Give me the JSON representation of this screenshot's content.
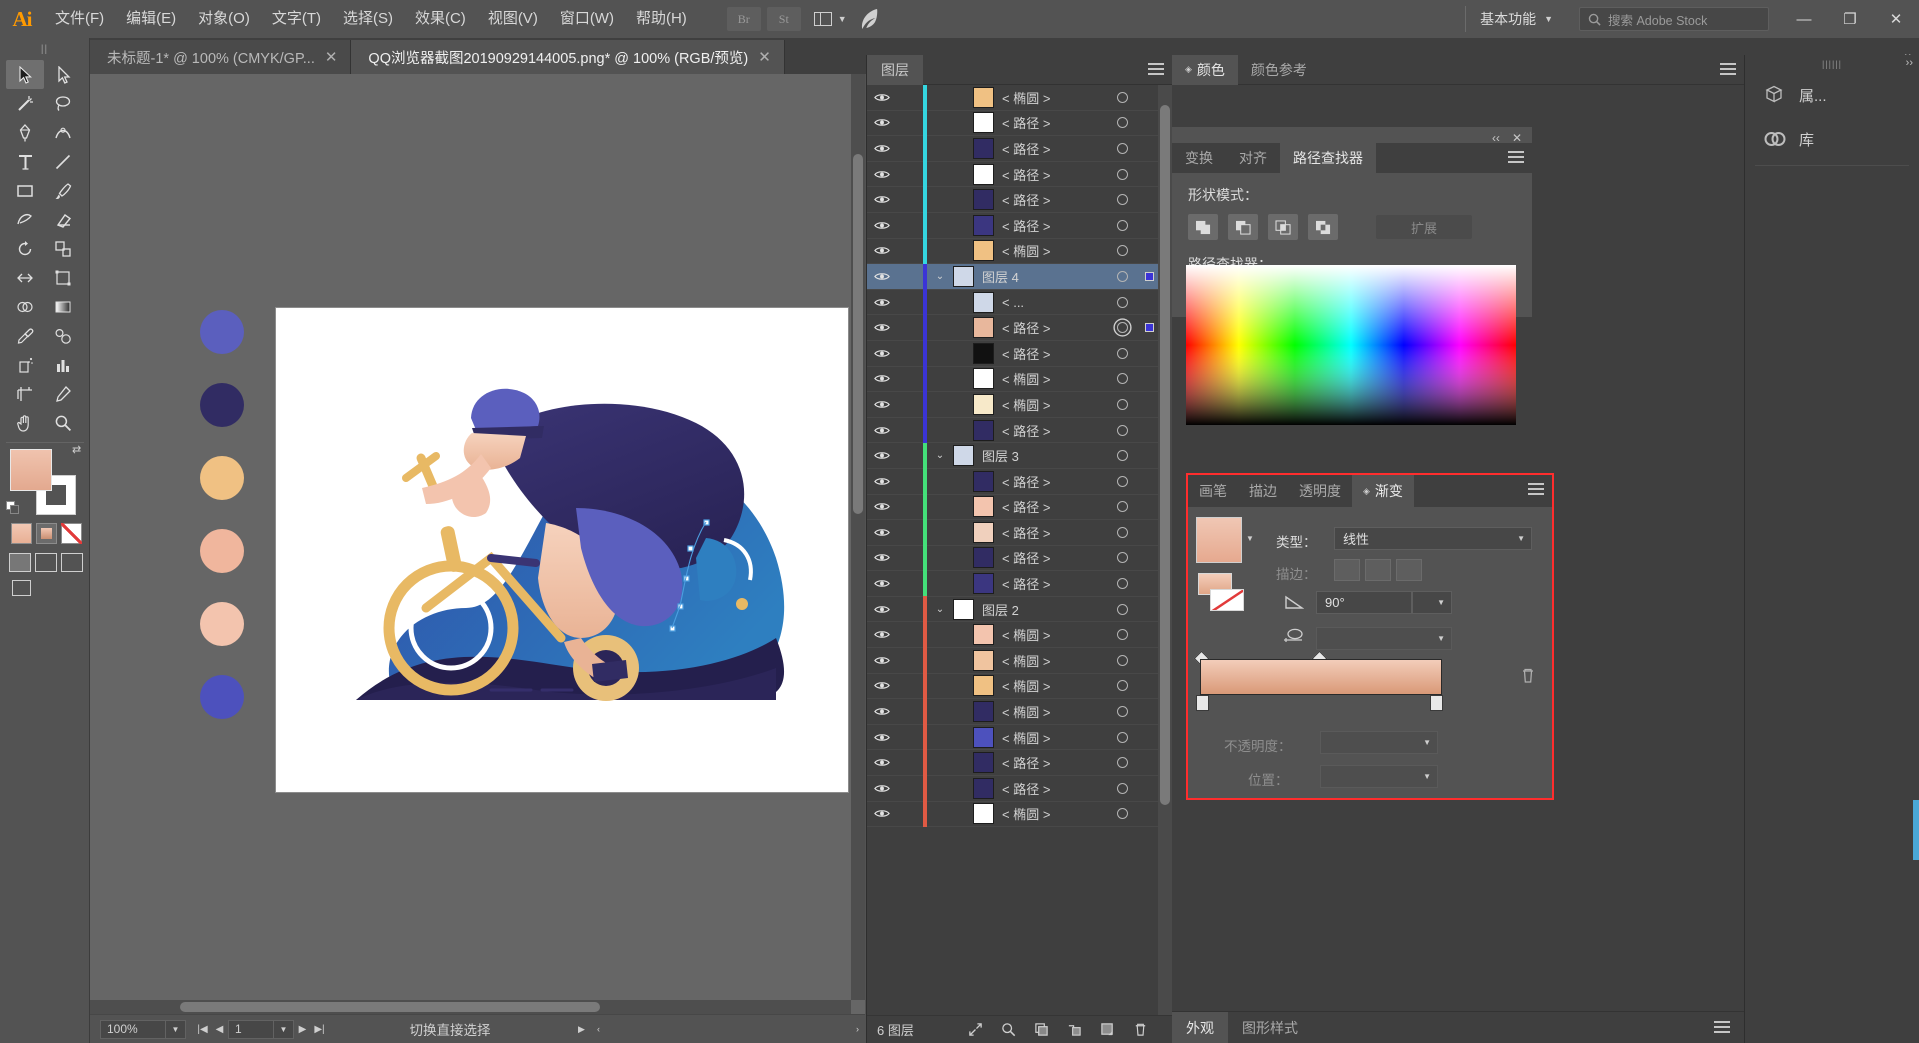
{
  "app": {
    "name": "Adobe Illustrator",
    "logo": "Ai",
    "bg_color": "#535353",
    "accent_color": "#ff9a00"
  },
  "menubar": {
    "items": [
      {
        "label": "文件(F)",
        "name": "menu-file"
      },
      {
        "label": "编辑(E)",
        "name": "menu-edit"
      },
      {
        "label": "对象(O)",
        "name": "menu-object"
      },
      {
        "label": "文字(T)",
        "name": "menu-type"
      },
      {
        "label": "选择(S)",
        "name": "menu-select"
      },
      {
        "label": "效果(C)",
        "name": "menu-effect"
      },
      {
        "label": "视图(V)",
        "name": "menu-view"
      },
      {
        "label": "窗口(W)",
        "name": "menu-window"
      },
      {
        "label": "帮助(H)",
        "name": "menu-help"
      }
    ],
    "bridge_label": "Br",
    "stock_label": "St",
    "workspace": "基本功能",
    "search_placeholder": "搜索 Adobe Stock",
    "win_minimize": "—",
    "win_restore": "❐",
    "win_close": "✕"
  },
  "tabs": [
    {
      "label": "未标题-1* @ 100% (CMYK/GP...",
      "active": false,
      "close": "✕"
    },
    {
      "label": "QQ浏览器截图20190929144005.png* @ 100% (RGB/预览)",
      "active": true,
      "close": "✕"
    }
  ],
  "toolbar": {
    "grip": "||",
    "tools": [
      {
        "name": "selection-tool",
        "selected": true
      },
      {
        "name": "direct-selection-tool",
        "selected": false
      },
      {
        "name": "magic-wand-tool",
        "selected": false
      },
      {
        "name": "lasso-tool",
        "selected": false
      },
      {
        "name": "pen-tool",
        "selected": false
      },
      {
        "name": "curvature-tool",
        "selected": false
      },
      {
        "name": "type-tool",
        "selected": false
      },
      {
        "name": "line-segment-tool",
        "selected": false
      },
      {
        "name": "rectangle-tool",
        "selected": false
      },
      {
        "name": "paintbrush-tool",
        "selected": false
      },
      {
        "name": "shaper-tool",
        "selected": false
      },
      {
        "name": "eraser-tool",
        "selected": false
      },
      {
        "name": "rotate-tool",
        "selected": false
      },
      {
        "name": "scale-tool",
        "selected": false
      },
      {
        "name": "width-tool",
        "selected": false
      },
      {
        "name": "free-transform-tool",
        "selected": false
      },
      {
        "name": "shape-builder-tool",
        "selected": false
      },
      {
        "name": "gradient-tool",
        "selected": false
      },
      {
        "name": "eyedropper-tool",
        "selected": false
      },
      {
        "name": "blend-tool",
        "selected": false
      },
      {
        "name": "symbol-sprayer-tool",
        "selected": false
      },
      {
        "name": "column-graph-tool",
        "selected": false
      },
      {
        "name": "artboard-tool",
        "selected": false
      },
      {
        "name": "slice-tool",
        "selected": false
      },
      {
        "name": "hand-tool",
        "selected": false
      },
      {
        "name": "zoom-tool",
        "selected": false
      }
    ]
  },
  "canvas": {
    "artboard_bg": "#ffffff",
    "swatches": [
      {
        "color": "#5b5fbe",
        "name": "swatch-indigo"
      },
      {
        "color": "#312c63",
        "name": "swatch-dark-navy"
      },
      {
        "color": "#f0c183",
        "name": "swatch-gold"
      },
      {
        "color": "#f0b69d",
        "name": "swatch-salmon"
      },
      {
        "color": "#f3c4ae",
        "name": "swatch-peach"
      },
      {
        "color": "#4d51bd",
        "name": "swatch-blue"
      }
    ],
    "illustration_alt": "Flat illustration of a cyclist riding a bicycle"
  },
  "statusbar": {
    "zoom": "100%",
    "page": "1",
    "status_text": "切换直接选择"
  },
  "layers_panel": {
    "tab_label": "图层",
    "footer_count": "6 图层",
    "footer_icons": [
      {
        "name": "locate-object-icon"
      },
      {
        "name": "make-clipping-mask-icon"
      },
      {
        "name": "create-new-sublayer-icon"
      },
      {
        "name": "create-new-layer-icon"
      },
      {
        "name": "delete-selection-icon"
      }
    ],
    "rows": [
      {
        "label": "< 椭圆 >",
        "type": "object",
        "indent": 2,
        "color": "#35d6e0",
        "thumb": "#f0c183",
        "selected": false,
        "target": "single",
        "has_sel_square": false,
        "expandable": false
      },
      {
        "label": "< 路径 >",
        "type": "object",
        "indent": 2,
        "color": "#35d6e0",
        "thumb": "#ffffff",
        "selected": false,
        "target": "single",
        "has_sel_square": false,
        "expandable": false
      },
      {
        "label": "< 路径 >",
        "type": "object",
        "indent": 2,
        "color": "#35d6e0",
        "thumb": "#312c63",
        "selected": false,
        "target": "single",
        "has_sel_square": false,
        "expandable": false
      },
      {
        "label": "< 路径 >",
        "type": "object",
        "indent": 2,
        "color": "#35d6e0",
        "thumb": "#ffffff",
        "selected": false,
        "target": "single",
        "has_sel_square": false,
        "expandable": false
      },
      {
        "label": "< 路径 >",
        "type": "object",
        "indent": 2,
        "color": "#35d6e0",
        "thumb": "#312c63",
        "selected": false,
        "target": "single",
        "has_sel_square": false,
        "expandable": false
      },
      {
        "label": "< 路径 >",
        "type": "object",
        "indent": 2,
        "color": "#35d6e0",
        "thumb": "#3b3680",
        "selected": false,
        "target": "single",
        "has_sel_square": false,
        "expandable": false
      },
      {
        "label": "< 椭圆 >",
        "type": "object",
        "indent": 2,
        "color": "#35d6e0",
        "thumb": "#f0c183",
        "selected": false,
        "target": "single",
        "has_sel_square": false,
        "expandable": false
      },
      {
        "label": "图层 4",
        "type": "layer",
        "indent": 0,
        "color": "#3b34d6",
        "thumb": "#cfd8e8",
        "selected": true,
        "target": "single",
        "has_sel_square": true,
        "expandable": true
      },
      {
        "label": "< ...",
        "type": "object",
        "indent": 2,
        "color": "#3b34d6",
        "thumb": "#cfd8e8",
        "selected": false,
        "target": "single",
        "has_sel_square": false,
        "expandable": false
      },
      {
        "label": "< 路径 >",
        "type": "object",
        "indent": 2,
        "color": "#3b34d6",
        "thumb": "#e8b79c",
        "selected": false,
        "target": "double",
        "has_sel_square": true,
        "expandable": false
      },
      {
        "label": "< 路径 >",
        "type": "object",
        "indent": 2,
        "color": "#3b34d6",
        "thumb": "#111111",
        "selected": false,
        "target": "single",
        "has_sel_square": false,
        "expandable": false
      },
      {
        "label": "< 椭圆 >",
        "type": "object",
        "indent": 2,
        "color": "#3b34d6",
        "thumb": "#ffffff",
        "selected": false,
        "target": "single",
        "has_sel_square": false,
        "expandable": false
      },
      {
        "label": "< 椭圆 >",
        "type": "object",
        "indent": 2,
        "color": "#3b34d6",
        "thumb": "#f7e9c9",
        "selected": false,
        "target": "single",
        "has_sel_square": false,
        "expandable": false
      },
      {
        "label": "< 路径 >",
        "type": "object",
        "indent": 2,
        "color": "#3b34d6",
        "thumb": "#312c63",
        "selected": false,
        "target": "single",
        "has_sel_square": false,
        "expandable": false
      },
      {
        "label": "图层 3",
        "type": "layer",
        "indent": 0,
        "color": "#44e07a",
        "thumb": "#cfd8e8",
        "selected": false,
        "target": "single",
        "has_sel_square": false,
        "expandable": true
      },
      {
        "label": "< 路径 >",
        "type": "object",
        "indent": 2,
        "color": "#44e07a",
        "thumb": "#312c63",
        "selected": false,
        "target": "single",
        "has_sel_square": false,
        "expandable": false
      },
      {
        "label": "< 路径 >",
        "type": "object",
        "indent": 2,
        "color": "#44e07a",
        "thumb": "#f3c4ae",
        "selected": false,
        "target": "single",
        "has_sel_square": false,
        "expandable": false
      },
      {
        "label": "< 路径 >",
        "type": "object",
        "indent": 2,
        "color": "#44e07a",
        "thumb": "#f0d0bd",
        "selected": false,
        "target": "single",
        "has_sel_square": false,
        "expandable": false
      },
      {
        "label": "< 路径 >",
        "type": "object",
        "indent": 2,
        "color": "#44e07a",
        "thumb": "#312c63",
        "selected": false,
        "target": "single",
        "has_sel_square": false,
        "expandable": false
      },
      {
        "label": "< 路径 >",
        "type": "object",
        "indent": 2,
        "color": "#44e07a",
        "thumb": "#3b3680",
        "selected": false,
        "target": "single",
        "has_sel_square": false,
        "expandable": false
      },
      {
        "label": "图层 2",
        "type": "layer",
        "indent": 0,
        "color": "#e05a44",
        "thumb": "#ffffff",
        "selected": false,
        "target": "single",
        "has_sel_square": false,
        "expandable": true
      },
      {
        "label": "< 椭圆 >",
        "type": "object",
        "indent": 2,
        "color": "#e05a44",
        "thumb": "#f3c4ae",
        "selected": false,
        "target": "single",
        "has_sel_square": false,
        "expandable": false
      },
      {
        "label": "< 椭圆 >",
        "type": "object",
        "indent": 2,
        "color": "#e05a44",
        "thumb": "#f0c49f",
        "selected": false,
        "target": "single",
        "has_sel_square": false,
        "expandable": false
      },
      {
        "label": "< 椭圆 >",
        "type": "object",
        "indent": 2,
        "color": "#e05a44",
        "thumb": "#f0c183",
        "selected": false,
        "target": "single",
        "has_sel_square": false,
        "expandable": false
      },
      {
        "label": "< 椭圆 >",
        "type": "object",
        "indent": 2,
        "color": "#e05a44",
        "thumb": "#312c63",
        "selected": false,
        "target": "single",
        "has_sel_square": false,
        "expandable": false
      },
      {
        "label": "< 椭圆 >",
        "type": "object",
        "indent": 2,
        "color": "#e05a44",
        "thumb": "#4d51bd",
        "selected": false,
        "target": "single",
        "has_sel_square": false,
        "expandable": false
      },
      {
        "label": "< 路径 >",
        "type": "object",
        "indent": 2,
        "color": "#e05a44",
        "thumb": "#312c63",
        "selected": false,
        "target": "single",
        "has_sel_square": false,
        "expandable": false
      },
      {
        "label": "< 路径 >",
        "type": "object",
        "indent": 2,
        "color": "#e05a44",
        "thumb": "#312c63",
        "selected": false,
        "target": "single",
        "has_sel_square": false,
        "expandable": false
      },
      {
        "label": "< 椭圆 >",
        "type": "object",
        "indent": 2,
        "color": "#e05a44",
        "thumb": "#ffffff",
        "selected": false,
        "target": "single",
        "has_sel_square": false,
        "expandable": false
      }
    ]
  },
  "color_panel": {
    "tabs": [
      {
        "label": "颜色",
        "active": true
      },
      {
        "label": "颜色参考",
        "active": false
      }
    ]
  },
  "pathfinder_panel": {
    "tabs": [
      {
        "label": "变换",
        "active": false
      },
      {
        "label": "对齐",
        "active": false
      },
      {
        "label": "路径查找器",
        "active": true
      }
    ],
    "shape_modes_label": "形状模式：",
    "pathfinder_label": "路径查找器：",
    "expand_label": "扩展",
    "shape_mode_buttons": [
      {
        "name": "unite-button"
      },
      {
        "name": "minus-front-button"
      },
      {
        "name": "intersect-button"
      },
      {
        "name": "exclude-button"
      }
    ],
    "pathfinder_buttons": [
      {
        "name": "divide-button"
      },
      {
        "name": "trim-button"
      },
      {
        "name": "merge-button"
      },
      {
        "name": "crop-button"
      },
      {
        "name": "outline-button"
      },
      {
        "name": "minus-back-button"
      }
    ]
  },
  "gradient_panel": {
    "tabs": [
      {
        "label": "画笔",
        "active": false
      },
      {
        "label": "描边",
        "active": false
      },
      {
        "label": "透明度",
        "active": false
      },
      {
        "label": "渐变",
        "active": true
      }
    ],
    "type_label": "类型：",
    "type_value": "线性",
    "stroke_label": "描边：",
    "angle_label": "角度",
    "angle_value": "90°",
    "aspect_label": "长宽比",
    "aspect_value": "",
    "opacity_label": "不透明度：",
    "opacity_value": "",
    "location_label": "位置：",
    "location_value": "",
    "gradient_start_color": "#f3cdba",
    "gradient_end_color": "#d99977",
    "highlight_color": "#ff2d2d",
    "delete_stop_icon": "delete-stop-icon"
  },
  "appearance_panel": {
    "tabs": [
      {
        "label": "外观",
        "active": true
      },
      {
        "label": "图形样式",
        "active": false
      }
    ]
  },
  "icon_dock": {
    "items": [
      {
        "label": "属...",
        "icon": "properties-icon"
      },
      {
        "label": "库",
        "icon": "libraries-icon"
      }
    ]
  }
}
